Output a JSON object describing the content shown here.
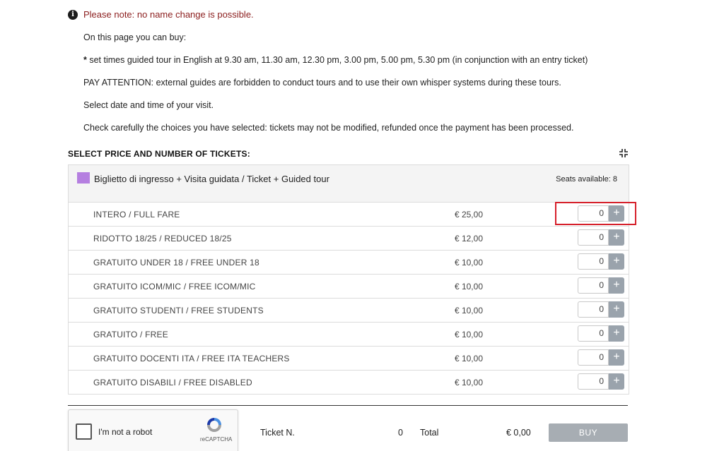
{
  "notice": {
    "icon": "info-icon",
    "text": "Please note: no name change is possible."
  },
  "info": {
    "intro": "On this page you can buy:",
    "tour_star": "*",
    "tour_text": " set times guided tour in English at 9.30 am, 11.30 am, 12.30 pm, 3.00 pm, 5.00 pm, 5.30 pm (in conjunction with an entry ticket)",
    "attention": "PAY ATTENTION: external guides are forbidden to conduct tours and to use their own whisper systems during these tours.",
    "select": "Select date and time of your visit.",
    "check": "Check carefully the choices you have selected: tickets may not be modified, refunded once the payment has been processed."
  },
  "section": {
    "title": "SELECT PRICE AND NUMBER OF TICKETS:",
    "collapse_icon": "collapse-icon"
  },
  "ticket": {
    "name": "Biglietto di ingresso + Visita guidata / Ticket + Guided tour",
    "swatch_color": "#b57fe0",
    "seats": "Seats available: 8",
    "rows": [
      {
        "label": "INTERO / FULL FARE",
        "price": "€ 25,00",
        "qty": "0"
      },
      {
        "label": "RIDOTTO 18/25 / REDUCED 18/25",
        "price": "€ 12,00",
        "qty": "0"
      },
      {
        "label": "GRATUITO UNDER 18 / FREE UNDER 18",
        "price": "€ 10,00",
        "qty": "0"
      },
      {
        "label": "GRATUITO ICOM/MIC / FREE ICOM/MIC",
        "price": "€ 10,00",
        "qty": "0"
      },
      {
        "label": "GRATUITO STUDENTI / FREE STUDENTS",
        "price": "€ 10,00",
        "qty": "0"
      },
      {
        "label": "GRATUITO / FREE",
        "price": "€ 10,00",
        "qty": "0"
      },
      {
        "label": "GRATUITO DOCENTI ITA / FREE ITA TEACHERS",
        "price": "€ 10,00",
        "qty": "0"
      },
      {
        "label": "GRATUITO DISABILI / FREE DISABLED",
        "price": "€ 10,00",
        "qty": "0"
      }
    ],
    "plus_symbol": "+"
  },
  "captcha": {
    "label": "I'm not a robot",
    "brand": "reCAPTCHA"
  },
  "summary": {
    "ticket_label": "Ticket N.",
    "ticket_count": "0",
    "total_label": "Total",
    "total_value": "€ 0,00",
    "buy_label": "BUY"
  },
  "colors": {
    "notice": "#8b1d1d",
    "highlight": "#d6202b",
    "buy_button": "#a7adb3",
    "plus_button": "#9aa3ac"
  }
}
